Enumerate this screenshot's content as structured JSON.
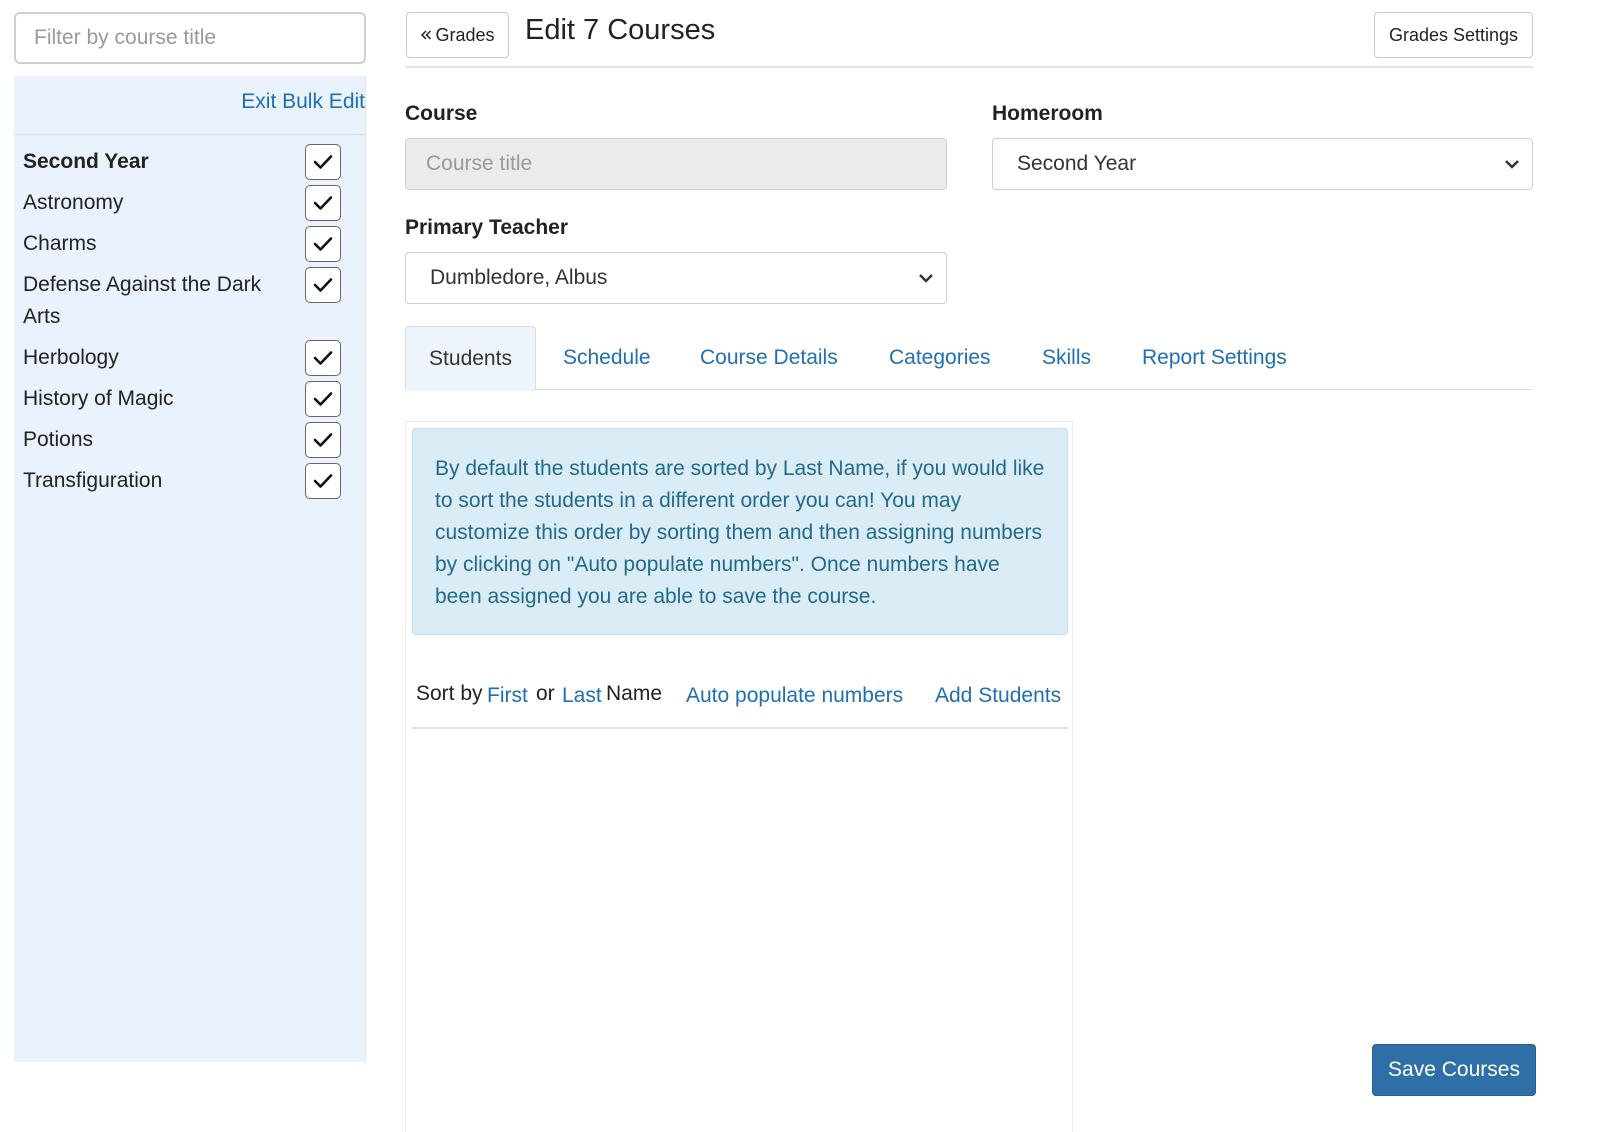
{
  "sidebar": {
    "filter_placeholder": "Filter by course title",
    "exit_label": "Exit Bulk Edit",
    "courses": [
      {
        "name": "Second Year",
        "bold": true,
        "checked": true
      },
      {
        "name": "Astronomy",
        "checked": true
      },
      {
        "name": "Charms",
        "checked": true
      },
      {
        "name": "Defense Against the Dark Arts",
        "checked": true
      },
      {
        "name": "Herbology",
        "checked": true
      },
      {
        "name": "History of Magic",
        "checked": true
      },
      {
        "name": "Potions",
        "checked": true
      },
      {
        "name": "Transfiguration",
        "checked": true
      }
    ]
  },
  "header": {
    "back_label": "Grades",
    "title": "Edit 7 Courses",
    "settings_label": "Grades Settings"
  },
  "form": {
    "course_label": "Course",
    "course_placeholder": "Course title",
    "homeroom_label": "Homeroom",
    "homeroom_value": "Second Year",
    "teacher_label": "Primary Teacher",
    "teacher_value": "Dumbledore, Albus"
  },
  "tabs": [
    {
      "label": "Students",
      "active": true
    },
    {
      "label": "Schedule"
    },
    {
      "label": "Course Details"
    },
    {
      "label": "Categories"
    },
    {
      "label": "Skills"
    },
    {
      "label": "Report Settings"
    }
  ],
  "students": {
    "info_text": "By default the students are sorted by Last Name, if you would like to sort the students in a different order you can! You may customize this order by sorting them and then assigning numbers by clicking on \"Auto populate numbers\". Once numbers have been assigned you are able to save the course.",
    "sort_by": "Sort by",
    "first_link": "First",
    "or_text": "or",
    "last_link": "Last",
    "name_text": "Name",
    "auto_populate": "Auto populate numbers",
    "add_students": "Add Students"
  },
  "save_label": "Save Courses",
  "colors": {
    "link": "#1f6fb2",
    "sidebar_bg": "#eaf2fe",
    "info_bg": "#daedf7",
    "primary_button": "#2f6fa8"
  }
}
